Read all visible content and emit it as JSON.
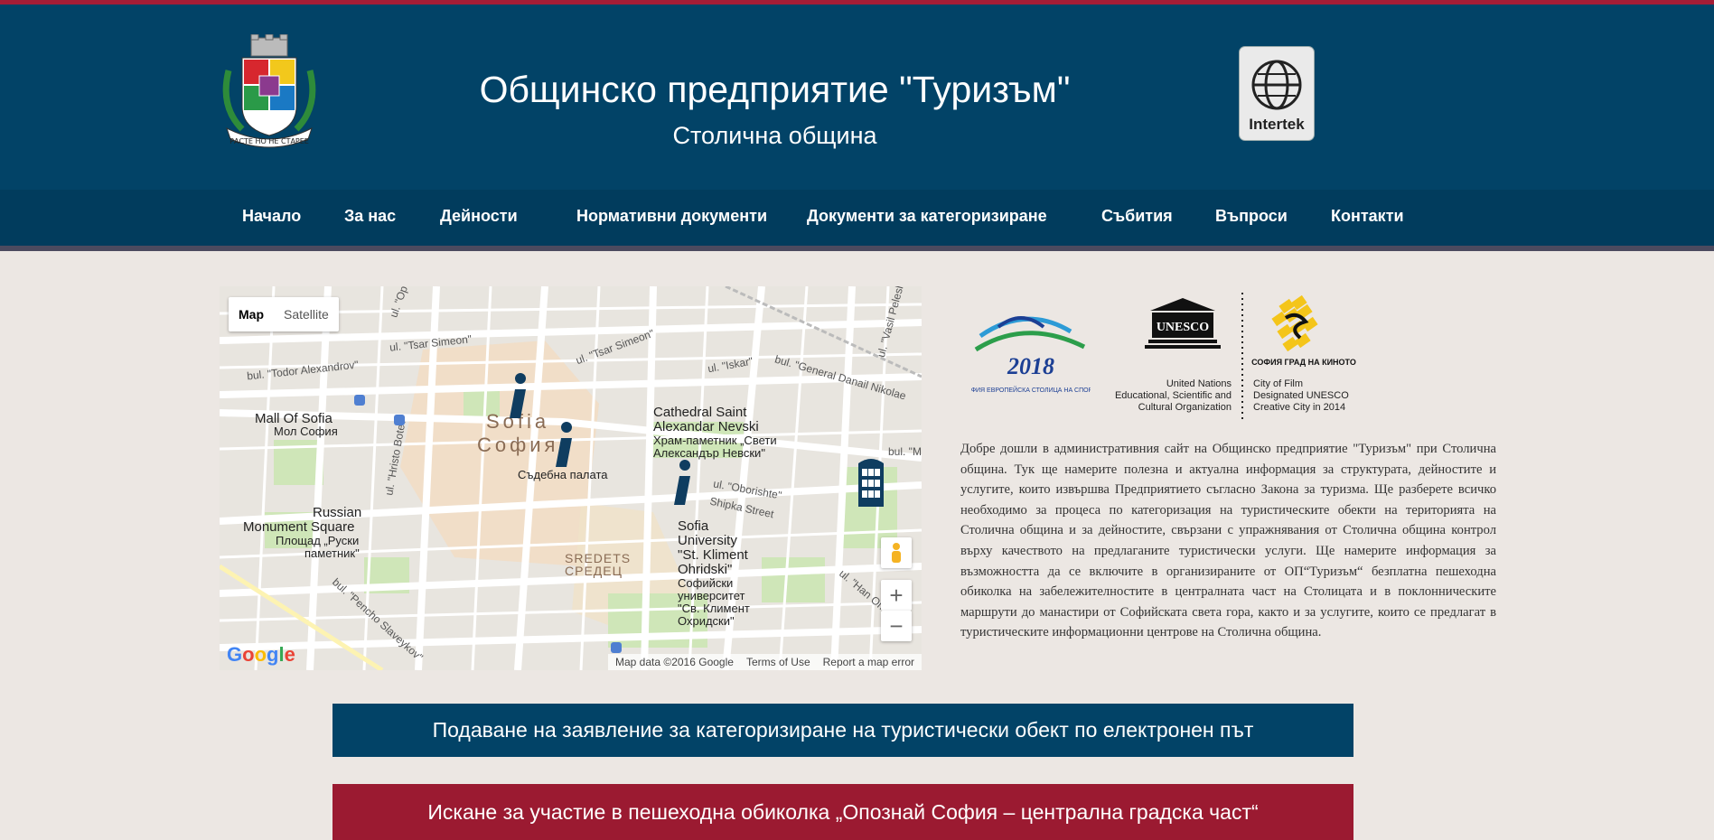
{
  "header": {
    "title": "Общинско предприятие \"Туризъм\"",
    "subtitle": "Столична община",
    "crest_motto": "РАСТЕ НО НЕ СТАРЕЕ",
    "cert_logo_text": "Intertek",
    "colors": {
      "header_bg": "#024367",
      "top_strip": "#a51d36",
      "nav_bg": "#013c5d"
    }
  },
  "nav": {
    "items": [
      {
        "label": "Начало"
      },
      {
        "label": "За нас"
      },
      {
        "label": "Дейности"
      },
      {
        "label": "Нормативни документи"
      },
      {
        "label": "Документи за категоризиране"
      },
      {
        "label": "Събития"
      },
      {
        "label": "Въпроси"
      },
      {
        "label": "Контакти"
      }
    ]
  },
  "map": {
    "view_toggle": [
      "Map",
      "Satellite"
    ],
    "active_view": "Map",
    "places": [
      "Mall Of Sofia",
      "Мол София",
      "Sofia",
      "София",
      "Съдебна палата",
      "Cathedral Saint",
      "Alexandar Nevski",
      "Храм-паметник „Свети",
      "Александър Невски\"",
      "Russian",
      "Monument Square",
      "Площад „Руски",
      "паметник\"",
      "Sofia",
      "University",
      "\"St. Kliment",
      "Ohridski\"",
      "Софийски",
      "университет",
      "\"Св. Климент",
      "Охридски\"",
      "SREDETS",
      "СРЕДЕЦ"
    ],
    "streets": [
      "ul. \"Tsar Simeon\"",
      "ul. \"Tsar Simeon\"",
      "bul. \"Todor Alexandrov\"",
      "ul. \"Iskar\"",
      "bul. \"General Danail Nikolae",
      "ul. \"Vasil Pelesh",
      "ul. \"Hristo Botev\"",
      "ul. \"Oborishte\"",
      "Shipka Street",
      "bul. \"Pencho Slaveykov\"",
      "ul. \"Han Om",
      "bul. \"Ma",
      "ul. \"Op"
    ],
    "footer": {
      "data": "Map data ©2016 Google",
      "terms": "Terms of Use",
      "report": "Report a map error"
    },
    "zoom_in": "+",
    "zoom_out": "−",
    "google_logo": "Google"
  },
  "partners": {
    "sofia2018": {
      "year": "2018",
      "caption": "СОФИЯ ЕВРОПЕЙСКА СТОЛИЦА НА СПОРТА"
    },
    "unesco": {
      "name": "UNESCO",
      "org_lines": [
        "United Nations",
        "Educational, Scientific and",
        "Cultural Organization"
      ],
      "city_lines": [
        "City of Film",
        "Designated UNESCO",
        "Creative City in 2014"
      ],
      "sofia_film": "СОФИЯ ГРАД НА КИНОТО"
    }
  },
  "welcome": "Добре дошли в административния сайт на Общинско предприятие \"Туризъм\" при Столична община. Тук ще намерите полезна и актуална информация за структурата, дейностите и услугите, които извършва Предприятието съгласно Закона за туризма. Ще разберете всичко необходимо за процеса по категоризация на туристическите обекти на територията на Столична община и за дейностите, свързани с упражнявания от Столична община контрол върху качеството на предлаганите туристически услуги. Ще намерите информация за възможността да се включите в организираните от ОП“Туризъм“ безплатна пешеходна обиколка на забележителностите в централната част на Столицата и в поклонническите маршрути до манастири от Софийската света гора, както и за услугите, които се предлагат в туристическите информационни центрове на Столична община.",
  "cta": {
    "apply": "Подаване на заявление за категоризиране на туристически обект по електронен път",
    "tour": "Искане за участие в пешеходна обиколка „Опознай София – централна градска част“"
  }
}
